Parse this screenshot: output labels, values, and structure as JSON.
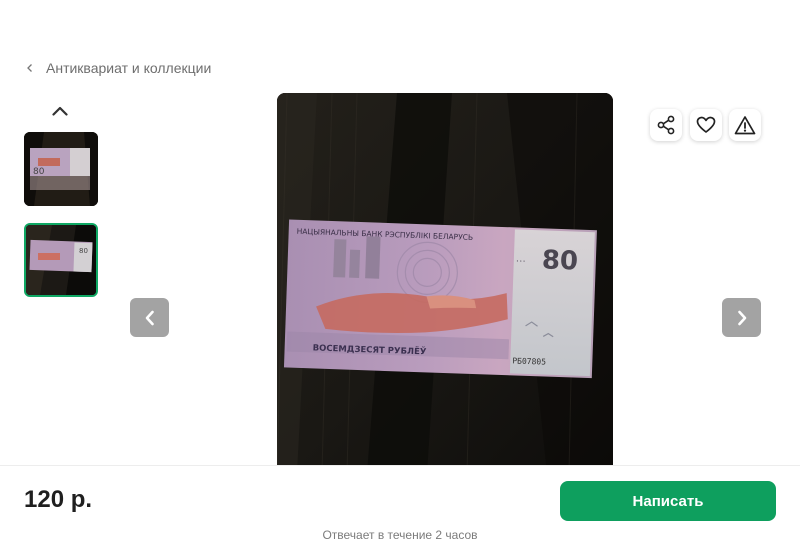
{
  "breadcrumb": {
    "label": "Антиквариат и коллекции"
  },
  "gallery": {
    "selected_index": 1,
    "thumbnail_count": 2,
    "banknote": {
      "bank_text": "НАЦЫЯНАЛЬНЫ БАНК РЭСПУБЛІКІ БЕЛАРУСЬ",
      "denomination": "80",
      "denomination_words": "ВОСЕМДЗЕСЯТ РУБЛЁЎ",
      "serial": "РБ07805"
    }
  },
  "listing": {
    "price": "120 р.",
    "write_button": "Написать",
    "response_note": "Отвечает в течение 2 часов"
  },
  "colors": {
    "accent": "#0e9f5e",
    "arrow_bg": "#a3a3a3"
  },
  "icons": [
    "chevron-left-icon",
    "chevron-up-icon",
    "share-icon",
    "heart-icon",
    "warning-icon",
    "arrow-left-icon",
    "arrow-right-icon"
  ]
}
